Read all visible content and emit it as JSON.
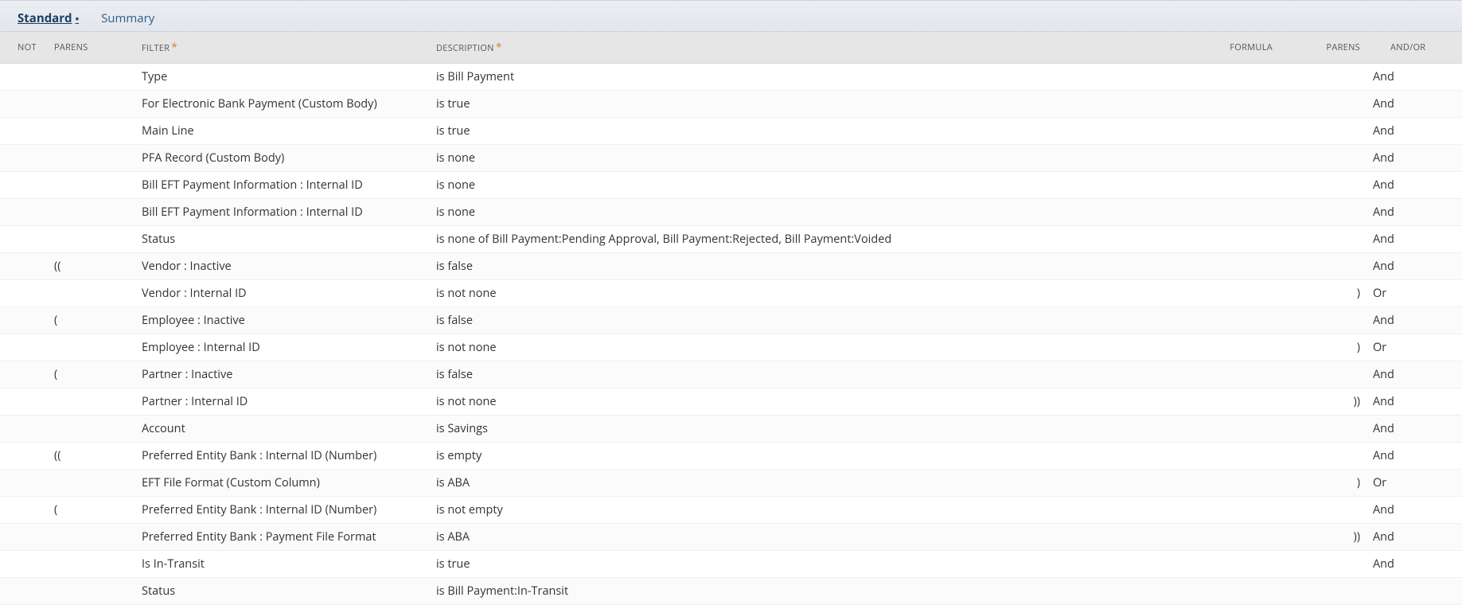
{
  "tabs": {
    "standard": "Standard",
    "dot": "•",
    "summary": "Summary"
  },
  "headers": {
    "not": "NOT",
    "parens_l": "PARENS",
    "filter": "FILTER",
    "description": "DESCRIPTION",
    "formula": "FORMULA",
    "parens_r": "PARENS",
    "andor": "AND/OR",
    "req": "*"
  },
  "rows": [
    {
      "not": "",
      "pl": "",
      "filter": "Type",
      "desc": "is Bill Payment",
      "formula": "",
      "pr": "",
      "andor": "And"
    },
    {
      "not": "",
      "pl": "",
      "filter": "For Electronic Bank Payment (Custom Body)",
      "desc": "is true",
      "formula": "",
      "pr": "",
      "andor": "And"
    },
    {
      "not": "",
      "pl": "",
      "filter": "Main Line",
      "desc": "is true",
      "formula": "",
      "pr": "",
      "andor": "And"
    },
    {
      "not": "",
      "pl": "",
      "filter": "PFA Record (Custom Body)",
      "desc": "is none",
      "formula": "",
      "pr": "",
      "andor": "And"
    },
    {
      "not": "",
      "pl": "",
      "filter": "Bill EFT Payment Information : Internal ID",
      "desc": "is none",
      "formula": "",
      "pr": "",
      "andor": "And"
    },
    {
      "not": "",
      "pl": "",
      "filter": "Bill EFT Payment Information : Internal ID",
      "desc": "is none",
      "formula": "",
      "pr": "",
      "andor": "And"
    },
    {
      "not": "",
      "pl": "",
      "filter": "Status",
      "desc": "is none of Bill Payment:Pending Approval, Bill Payment:Rejected, Bill Payment:Voided",
      "formula": "",
      "pr": "",
      "andor": "And"
    },
    {
      "not": "",
      "pl": "((",
      "filter": "Vendor : Inactive",
      "desc": "is false",
      "formula": "",
      "pr": "",
      "andor": "And"
    },
    {
      "not": "",
      "pl": "",
      "filter": "Vendor : Internal ID",
      "desc": "is not none",
      "formula": "",
      "pr": ")",
      "andor": "Or"
    },
    {
      "not": "",
      "pl": "(",
      "filter": "Employee : Inactive",
      "desc": "is false",
      "formula": "",
      "pr": "",
      "andor": "And"
    },
    {
      "not": "",
      "pl": "",
      "filter": "Employee : Internal ID",
      "desc": "is not none",
      "formula": "",
      "pr": ")",
      "andor": "Or"
    },
    {
      "not": "",
      "pl": "(",
      "filter": "Partner : Inactive",
      "desc": "is false",
      "formula": "",
      "pr": "",
      "andor": "And"
    },
    {
      "not": "",
      "pl": "",
      "filter": "Partner : Internal ID",
      "desc": "is not none",
      "formula": "",
      "pr": "))",
      "andor": "And"
    },
    {
      "not": "",
      "pl": "",
      "filter": "Account",
      "desc": "is Savings",
      "formula": "",
      "pr": "",
      "andor": "And"
    },
    {
      "not": "",
      "pl": "((",
      "filter": "Preferred Entity Bank : Internal ID (Number)",
      "desc": "is empty",
      "formula": "",
      "pr": "",
      "andor": "And"
    },
    {
      "not": "",
      "pl": "",
      "filter": "EFT File Format (Custom Column)",
      "desc": "is ABA",
      "formula": "",
      "pr": ")",
      "andor": "Or"
    },
    {
      "not": "",
      "pl": "(",
      "filter": "Preferred Entity Bank : Internal ID (Number)",
      "desc": "is not empty",
      "formula": "",
      "pr": "",
      "andor": "And"
    },
    {
      "not": "",
      "pl": "",
      "filter": "Preferred Entity Bank : Payment File Format",
      "desc": "is ABA",
      "formula": "",
      "pr": "))",
      "andor": "And"
    },
    {
      "not": "",
      "pl": "",
      "filter": "Is In-Transit",
      "desc": "is true",
      "formula": "",
      "pr": "",
      "andor": "And"
    },
    {
      "not": "",
      "pl": "",
      "filter": "Status",
      "desc": "is Bill Payment:In-Transit",
      "formula": "",
      "pr": "",
      "andor": ""
    }
  ]
}
